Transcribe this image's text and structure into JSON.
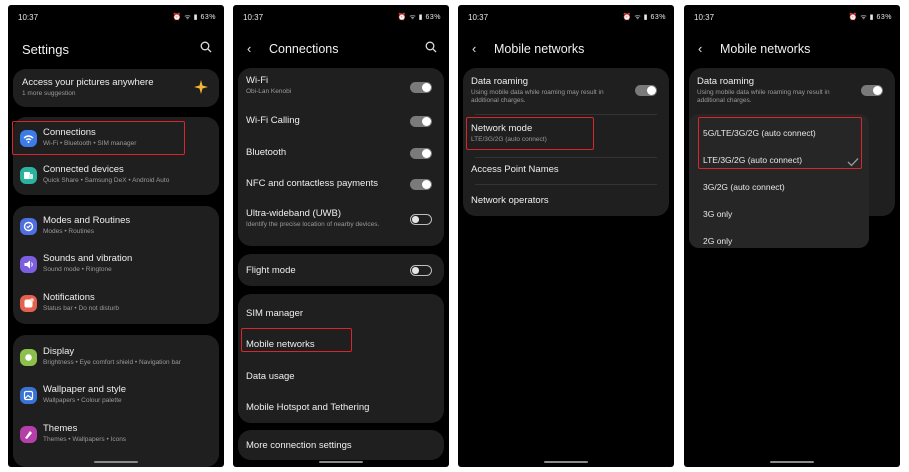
{
  "status": {
    "time": "10:37",
    "battery": "63%"
  },
  "screen1": {
    "title": "Settings",
    "banner": {
      "title": "Access your pictures anywhere",
      "subtitle": "1 more suggestion"
    },
    "items": [
      {
        "label": "Connections",
        "sub": "Wi-Fi  •  Bluetooth  •  SIM manager",
        "color": "#3d7be6"
      },
      {
        "label": "Connected devices",
        "sub": "Quick Share  •  Samsung DeX  •  Android Auto",
        "color": "#2bb3a0"
      },
      {
        "label": "Modes and Routines",
        "sub": "Modes  •  Routines",
        "color": "#4f6fe0"
      },
      {
        "label": "Sounds and vibration",
        "sub": "Sound mode  •  Ringtone",
        "color": "#7b5fe0"
      },
      {
        "label": "Notifications",
        "sub": "Status bar  •  Do not disturb",
        "color": "#e5604e"
      },
      {
        "label": "Display",
        "sub": "Brightness  •  Eye comfort shield  •  Navigation bar",
        "color": "#8cc04a"
      },
      {
        "label": "Wallpaper and style",
        "sub": "Wallpapers  •  Colour palette",
        "color": "#3a73d6"
      },
      {
        "label": "Themes",
        "sub": "Themes  •  Wallpapers  •  Icons",
        "color": "#b53fa8"
      }
    ]
  },
  "screen2": {
    "title": "Connections",
    "wifi": {
      "label": "Wi-Fi",
      "sub": "Obi-Lan Kenobi"
    },
    "wifi_calling": "Wi-Fi Calling",
    "bluetooth": "Bluetooth",
    "nfc": "NFC and contactless payments",
    "uwb": {
      "label": "Ultra-wideband (UWB)",
      "sub": "Identify the precise location of nearby devices."
    },
    "flight_mode": "Flight mode",
    "sim_manager": "SIM manager",
    "mobile_networks": "Mobile networks",
    "data_usage": "Data usage",
    "hotspot": "Mobile Hotspot and Tethering",
    "more": "More connection settings"
  },
  "screen3": {
    "title": "Mobile networks",
    "data_roaming": {
      "label": "Data roaming",
      "sub": "Using mobile data while roaming may result in additional charges."
    },
    "network_mode": {
      "label": "Network mode",
      "sub": "LTE/3G/2G (auto connect)"
    },
    "apn": "Access Point Names",
    "operators": "Network operators"
  },
  "screen4": {
    "title": "Mobile networks",
    "data_roaming": {
      "label": "Data roaming",
      "sub": "Using mobile data while roaming may result in additional charges."
    },
    "options": [
      "5G/LTE/3G/2G (auto connect)",
      "LTE/3G/2G (auto connect)",
      "3G/2G (auto connect)",
      "3G only",
      "2G only"
    ],
    "selected_index": 1
  },
  "colors": {
    "highlight": "#d9262e",
    "accent_star": "#f5b731"
  }
}
